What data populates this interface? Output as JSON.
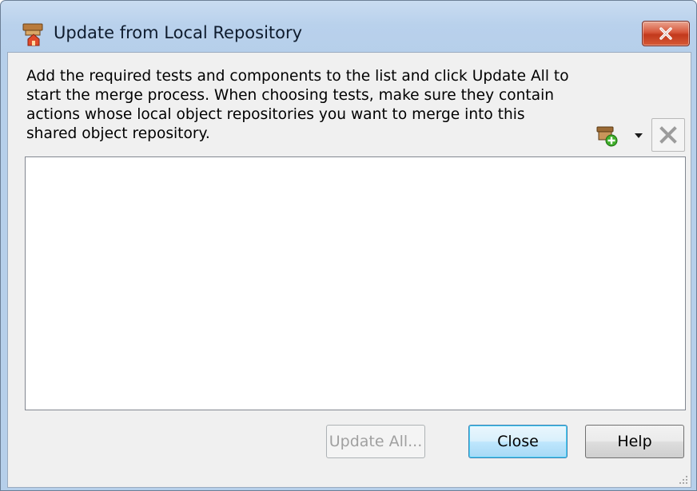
{
  "window": {
    "title": "Update from Local Repository"
  },
  "instructions": {
    "text": "Add the required tests and components to the list and click Update All to start the merge process. When choosing tests, make sure they contain actions whose local object repositories you want to merge into this shared object repository."
  },
  "toolbar": {
    "add_icon": "add-test-icon",
    "dropdown_icon": "chevron-down-icon",
    "remove_icon": "remove-x-icon"
  },
  "list": {
    "items": []
  },
  "buttons": {
    "update_all": "Update All...",
    "close": "Close",
    "help": "Help"
  },
  "colors": {
    "title_bar": "#b9d1ec",
    "close_button": "#c2391c",
    "client_bg": "#f0f0f0",
    "default_button": "#a7d9f5"
  }
}
